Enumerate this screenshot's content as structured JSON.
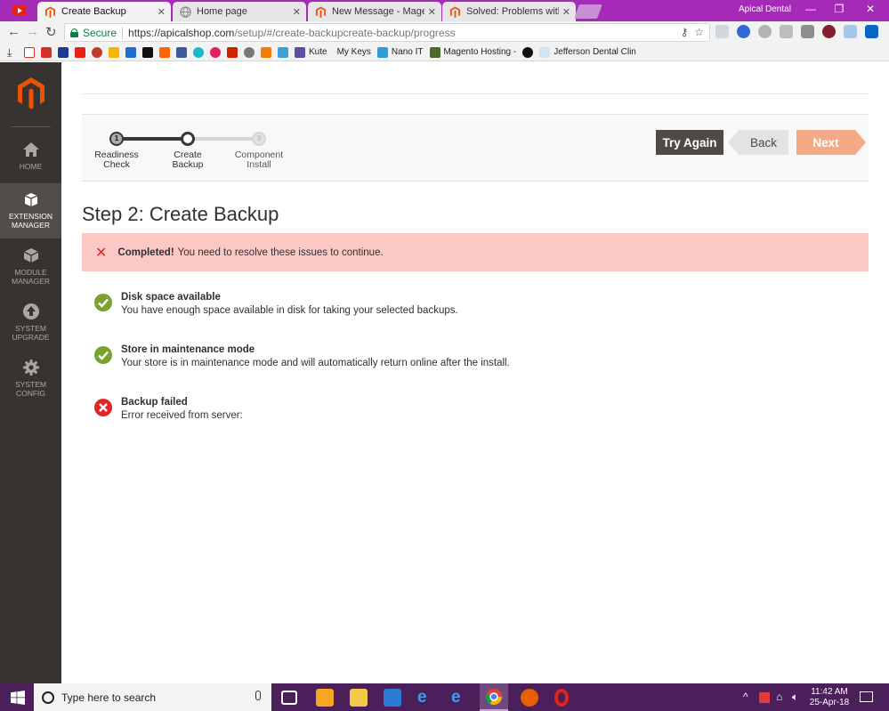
{
  "browser": {
    "tabs": [
      {
        "title": "Create Backup",
        "active": true
      },
      {
        "title": "Home page",
        "active": false
      },
      {
        "title": "New Message - Magento",
        "active": false
      },
      {
        "title": "Solved: Problems with ba",
        "active": false
      }
    ],
    "profile_name": "Apical Dental",
    "window_controls": [
      "—",
      "❐",
      "✕"
    ],
    "secure_label": "Secure",
    "url_host": "https://apicalshop.com",
    "url_path": "/setup/#/create-backupcreate-backup/progress",
    "bookmarks": [
      "Kute",
      "My Keys",
      "Nano IT",
      "Magento Hosting -",
      "Jefferson Dental Clin"
    ]
  },
  "sidebar": {
    "items": [
      {
        "label": "Home",
        "icon": "home-icon",
        "active": false
      },
      {
        "label": "Extension Manager",
        "icon": "box-icon",
        "active": true
      },
      {
        "label": "Module Manager",
        "icon": "cube-icon",
        "active": false
      },
      {
        "label": "System Upgrade",
        "icon": "upgrade-icon",
        "active": false
      },
      {
        "label": "System Config",
        "icon": "gear-icon",
        "active": false
      }
    ]
  },
  "wizard": {
    "steps": [
      {
        "number": "1",
        "line1": "Readiness",
        "line2": "Check",
        "state": "done"
      },
      {
        "number": "2",
        "line1": "Create",
        "line2": "Backup",
        "state": "current"
      },
      {
        "number": "3",
        "line1": "Component",
        "line2": "Install",
        "state": "todo"
      }
    ],
    "buttons": {
      "try_again": "Try Again",
      "back": "Back",
      "next": "Next"
    },
    "title": "Step 2: Create Backup",
    "banner": {
      "strong": "Completed!",
      "text": "You need to resolve these issues to continue."
    },
    "checks": [
      {
        "status": "success",
        "title": "Disk space available",
        "desc": "You have enough space available in disk for taking your selected backups."
      },
      {
        "status": "success",
        "title": "Store in maintenance mode",
        "desc": "Your store is in maintenance mode and will automatically return online after the install."
      },
      {
        "status": "error",
        "title": "Backup failed",
        "desc": "Error received from server:"
      }
    ]
  },
  "taskbar": {
    "search_placeholder": "Type here to search",
    "time": "11:42 AM",
    "date": "25-Apr-18"
  },
  "colors": {
    "browser_frame": "#a52ab7",
    "sidebar_bg": "#373330",
    "sidebar_active": "#524d49",
    "magento_orange": "#eb5202",
    "error_bg": "#fcc8c5",
    "success_green": "#79a22e",
    "error_red": "#e22626",
    "next_button": "#f4aa86",
    "try_again_button": "#514943",
    "taskbar_bg": "#4a1f5a"
  }
}
